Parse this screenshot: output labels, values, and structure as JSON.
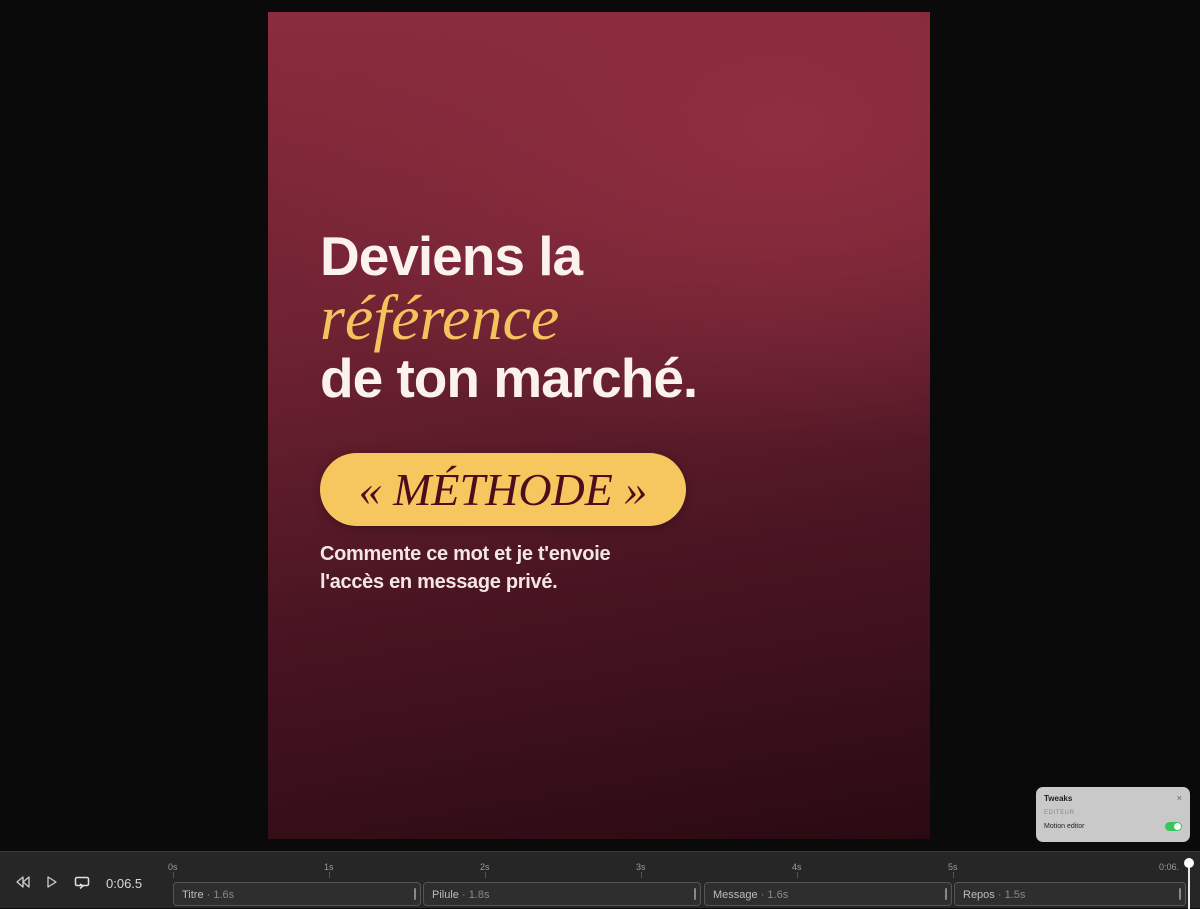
{
  "canvas": {
    "headline_line1": "Deviens la",
    "headline_accent": "référence",
    "headline_line3": "de ton marché.",
    "keyword_pill": "« MÉTHODE »",
    "message": "Commente ce mot et je t'envoie l'accès en message privé."
  },
  "colors": {
    "background_top": "#8a2c3d",
    "background_bottom": "#2a0a12",
    "accent_gold": "#f4c35e",
    "pill_bg": "#f7c75f",
    "toggle_on": "#35c759"
  },
  "tweaks": {
    "title": "Tweaks",
    "close": "×",
    "section": "EDITEUR",
    "motion_editor_label": "Motion editor",
    "motion_editor_enabled": true
  },
  "timeline": {
    "current_time": "0:06.5",
    "ticks": [
      "0s",
      "1s",
      "2s",
      "3s",
      "4s",
      "5s",
      "0:06."
    ],
    "clips": [
      {
        "name": "Titre",
        "duration": "1.6s"
      },
      {
        "name": "Pilule",
        "duration": "1.8s"
      },
      {
        "name": "Message",
        "duration": "1.6s"
      },
      {
        "name": "Repos",
        "duration": "1.5s"
      }
    ],
    "icons": [
      "rewind-icon",
      "play-icon",
      "loop-icon"
    ]
  }
}
